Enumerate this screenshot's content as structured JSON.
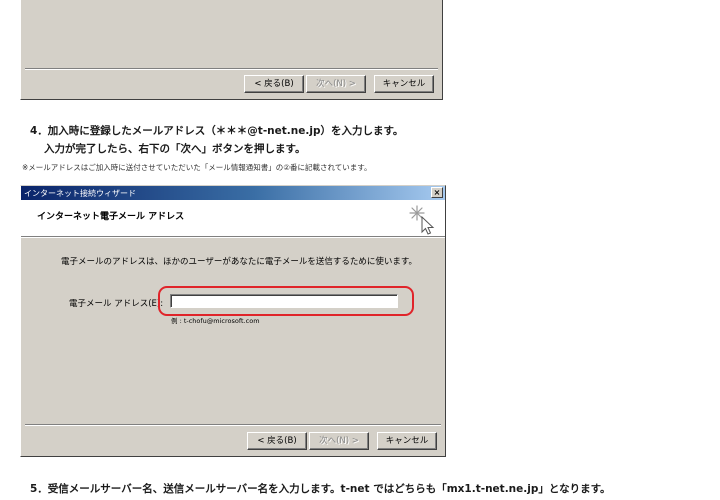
{
  "prev_dialog": {
    "buttons": {
      "back": "< 戻る(B)",
      "next": "次へ(N) >",
      "cancel": "キャンセル"
    }
  },
  "step4": {
    "line1": "4．加入時に登録したメールアドレス（＊＊＊@t-net.ne.jp）を入力します。",
    "line2": "入力が完了したら、右下の「次へ」ボタンを押します。",
    "note": "※メールアドレスはご加入時に送付させていただいた「メール情報通知書」の②番に記載されています。"
  },
  "dialog": {
    "title": "インターネット接続ウィザード",
    "close": "×",
    "header_title": "インターネット電子メール アドレス",
    "description": "電子メールのアドレスは、ほかのユーザーがあなたに電子メールを送信するために使います。",
    "field_label": "電子メール アドレス(E):",
    "field_value": "",
    "example": "例 : t-chofu@microsoft.com",
    "buttons": {
      "back": "< 戻る(B)",
      "next": "次へ(N) >",
      "cancel": "キャンセル"
    }
  },
  "step5": {
    "line": "5．受信メールサーバー名、送信メールサーバー名を入力します。t-net ではどちらも「mx1.t-net.ne.jp」となります。"
  },
  "colors": {
    "dialog_face": "#d4d0c8",
    "titlebar_start": "#0a246a",
    "titlebar_end": "#a6caf0",
    "highlight_ring": "#e0242a"
  }
}
